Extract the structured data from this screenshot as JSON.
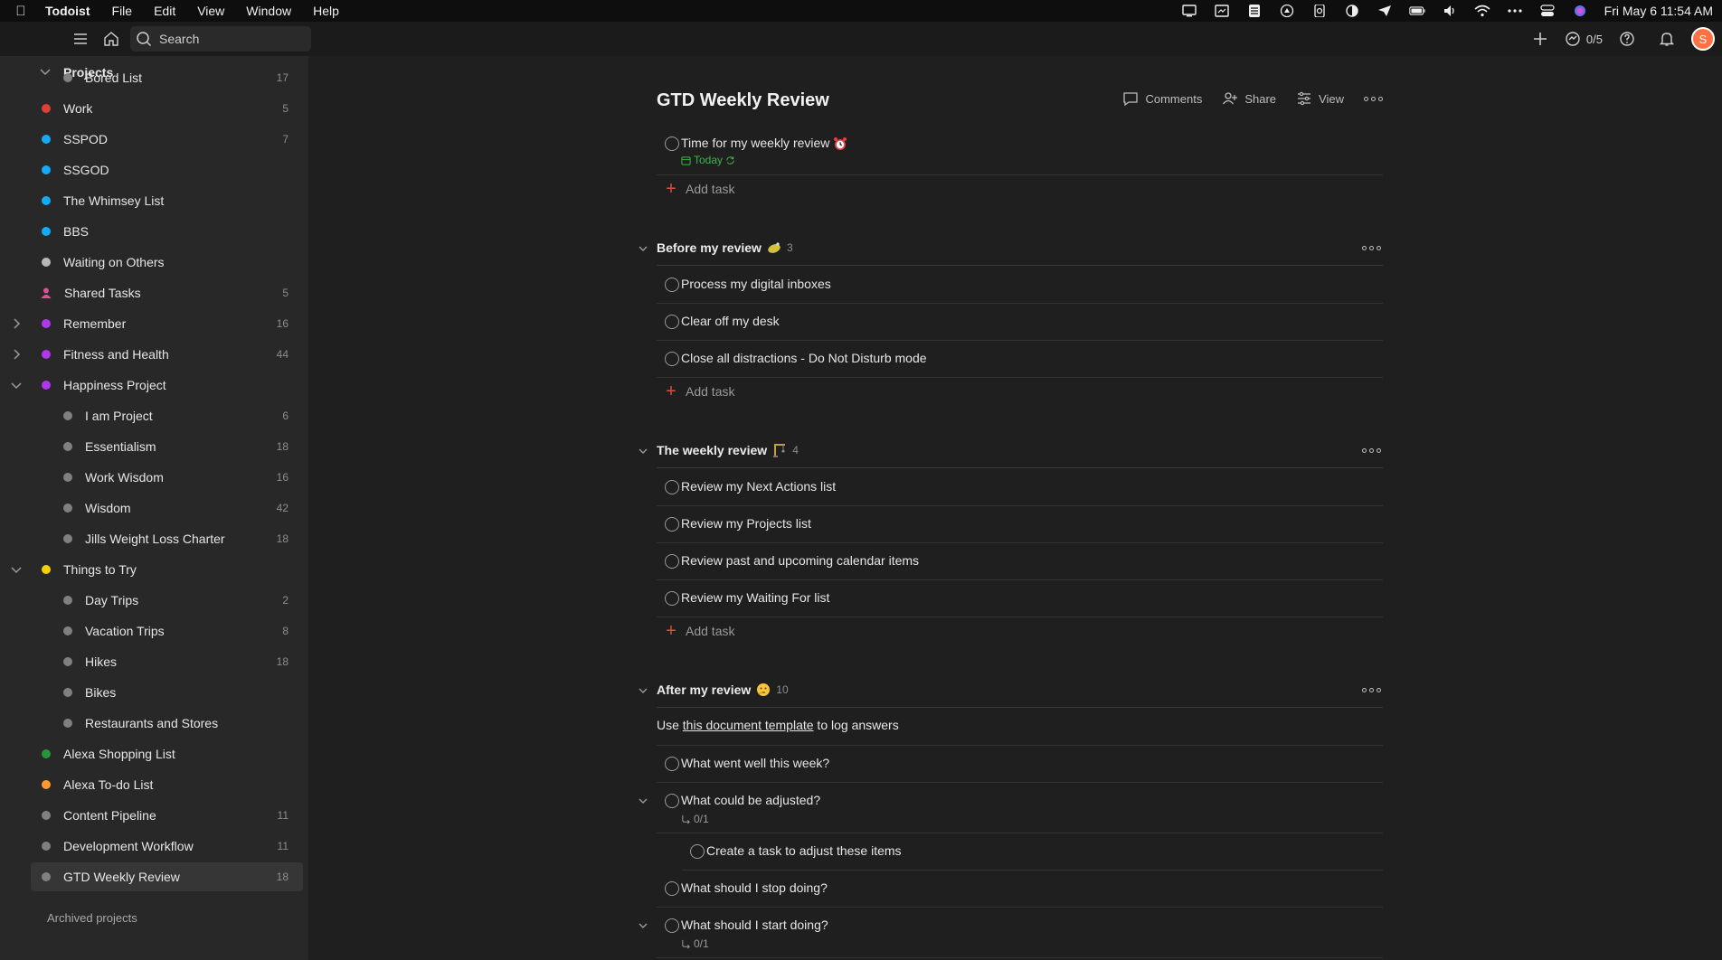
{
  "menubar": {
    "app_name": "Todoist",
    "menus": [
      "File",
      "Edit",
      "View",
      "Window",
      "Help"
    ],
    "clock": "Fri May 6  11:54 AM"
  },
  "topbar": {
    "search_placeholder": "Search",
    "karma": "0/5",
    "avatar_initial": "S"
  },
  "sidebar": {
    "projects_heading": "Projects",
    "projects": [
      {
        "label": "Bored List",
        "count": "17",
        "color": "#808080"
      },
      {
        "label": "Work",
        "count": "5",
        "color": "#db4035"
      },
      {
        "label": "SSPOD",
        "count": "7",
        "color": "#14aaf5"
      },
      {
        "label": "SSGOD",
        "count": "",
        "color": "#14aaf5"
      },
      {
        "label": "The Whimsey List",
        "count": "",
        "color": "#14aaf5"
      },
      {
        "label": "BBS",
        "count": "",
        "color": "#14aaf5"
      },
      {
        "label": "Waiting on Others",
        "count": "",
        "color": "#b8b8b8"
      },
      {
        "label": "Shared Tasks",
        "count": "5",
        "color": "#e05194"
      },
      {
        "label": "Remember",
        "count": "16",
        "color": "#af38eb"
      },
      {
        "label": "Fitness and Health",
        "count": "44",
        "color": "#af38eb"
      },
      {
        "label": "Happiness Project",
        "count": "",
        "color": "#af38eb"
      },
      {
        "label": "I am Project",
        "count": "6",
        "color": "#808080"
      },
      {
        "label": "Essentialism",
        "count": "18",
        "color": "#808080"
      },
      {
        "label": "Work Wisdom",
        "count": "16",
        "color": "#808080"
      },
      {
        "label": "Wisdom",
        "count": "42",
        "color": "#808080"
      },
      {
        "label": "Jills Weight Loss Charter",
        "count": "18",
        "color": "#808080"
      },
      {
        "label": "Things to Try",
        "count": "",
        "color": "#fad000"
      },
      {
        "label": "Day Trips",
        "count": "2",
        "color": "#808080"
      },
      {
        "label": "Vacation Trips",
        "count": "8",
        "color": "#808080"
      },
      {
        "label": "Hikes",
        "count": "18",
        "color": "#808080"
      },
      {
        "label": "Bikes",
        "count": "",
        "color": "#808080"
      },
      {
        "label": "Restaurants and Stores",
        "count": "",
        "color": "#808080"
      },
      {
        "label": "Alexa Shopping List",
        "count": "",
        "color": "#299438"
      },
      {
        "label": "Alexa To-do List",
        "count": "",
        "color": "#ff9933"
      },
      {
        "label": "Content Pipeline",
        "count": "11",
        "color": "#808080"
      },
      {
        "label": "Development Workflow",
        "count": "11",
        "color": "#808080"
      },
      {
        "label": "GTD Weekly Review",
        "count": "18",
        "color": "#808080"
      }
    ],
    "archived": "Archived projects"
  },
  "main": {
    "title": "GTD Weekly Review",
    "actions": {
      "comments": "Comments",
      "share": "Share",
      "view": "View"
    },
    "top_task": {
      "text": "Time for my weekly review",
      "due": "Today"
    },
    "add_task": "Add task",
    "sections": [
      {
        "title": "Before my review",
        "count": "3",
        "tasks": [
          "Process my digital inboxes",
          "Clear off my desk",
          "Close all distractions - Do Not Disturb mode"
        ]
      },
      {
        "title": "The weekly review",
        "count": "4",
        "tasks": [
          "Review my Next Actions list",
          "Review my Projects list",
          "Review past and upcoming calendar items",
          "Review my Waiting For list"
        ]
      },
      {
        "title": "After my review",
        "count": "10",
        "note_prefix": "Use ",
        "note_link": "this document template",
        "note_suffix": " to log answers",
        "tasks": [
          "What went well this week?",
          "What could be adjusted?",
          "Create a task to adjust these items",
          "What should I stop doing?",
          "What should I start doing?"
        ],
        "subtask_counts": [
          "0/1",
          "0/1"
        ]
      }
    ]
  }
}
